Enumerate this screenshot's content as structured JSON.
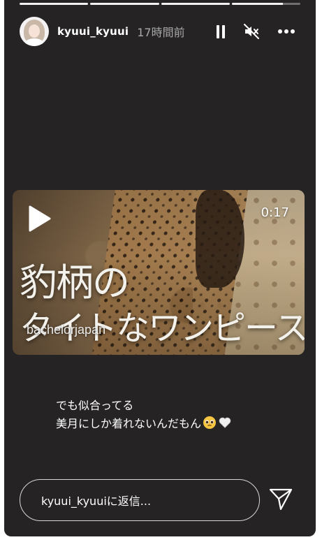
{
  "story": {
    "progress": [
      1,
      1,
      1,
      0.75
    ]
  },
  "header": {
    "username": "kyuui_kyuui",
    "time": "17時間前",
    "icons": [
      "pause-icon",
      "mute-icon",
      "more-icon"
    ]
  },
  "video": {
    "duration": "0:17",
    "caption_line1": "豹柄の",
    "caption_line2": "タイトなワンピース",
    "watermark": "bachelorjapan"
  },
  "message": {
    "line1": "でも似合ってる",
    "line2": "美月にしか着れないんだもん",
    "emojis": [
      "pleading-face",
      "white-heart"
    ]
  },
  "reply": {
    "placeholder": "kyuui_kyuuiに返信..."
  },
  "colors": {
    "background": "#252324",
    "text": "#ffffff",
    "muted": "#a9a8a8"
  }
}
